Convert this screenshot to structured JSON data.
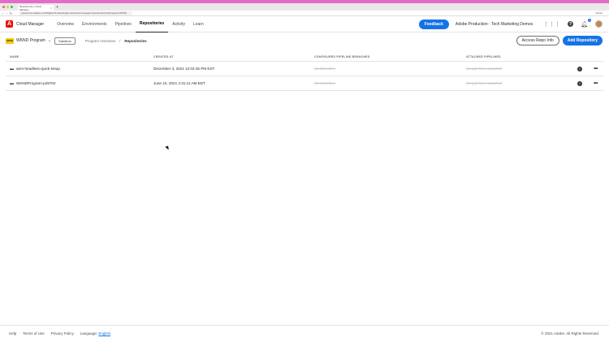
{
  "browser": {
    "tab_title": "Repositories | Cloud Manager",
    "tab_close": "×",
    "new_tab": "+",
    "url": "experience.adobe.com/#/@techmarketingdemos/cloud-manager/repositories.html/program/45768",
    "pause_label": "Pause"
  },
  "header": {
    "app_name": "Cloud Manager",
    "nav": [
      {
        "label": "Overview"
      },
      {
        "label": "Environments"
      },
      {
        "label": "Pipelines"
      },
      {
        "label": "Repositories"
      },
      {
        "label": "Activity"
      },
      {
        "label": "Learn"
      }
    ],
    "active_nav": "Repositories",
    "feedback_label": "Feedback",
    "org_name": "Adobe Production - Tech Marketing Demos",
    "notification_count": "1"
  },
  "subnav": {
    "program_badge": "WKND",
    "program_name": "WKND Program",
    "sandbox_label": "Sandbox",
    "breadcrumbs": [
      "Program Overview",
      "Repositories"
    ],
    "breadcrumb_separator": "/",
    "access_repo_label": "Access Repo Info",
    "add_repo_label": "Add Repository"
  },
  "table": {
    "headers": [
      "NAME",
      "CREATED AT",
      "CONFIGURED PIPELINE BRANCHES",
      "ATTACHED PIPELINES"
    ],
    "rows": [
      {
        "name": "aem-headless-quick-setup",
        "created_at": "December 3, 2021 12:02:45 PM EST",
        "branches": "No branches",
        "pipelines": "No pipelines attached"
      },
      {
        "name": "WKNDProgram-p29702",
        "created_at": "June 10, 2021 4:31:11 AM EDT",
        "branches": "No branches",
        "pipelines": "No pipelines attached"
      }
    ]
  },
  "footer": {
    "help": "Help",
    "terms": "Terms of Use",
    "privacy": "Privacy Policy",
    "language_label": "Language:",
    "language": "English",
    "copyright": "© 2021 Adobe. All Rights Reserved."
  },
  "colors": {
    "accent": "#1473e6",
    "logo": "#eb1000",
    "program_badge": "#f2c80f",
    "menubar": "#e56bc9"
  }
}
